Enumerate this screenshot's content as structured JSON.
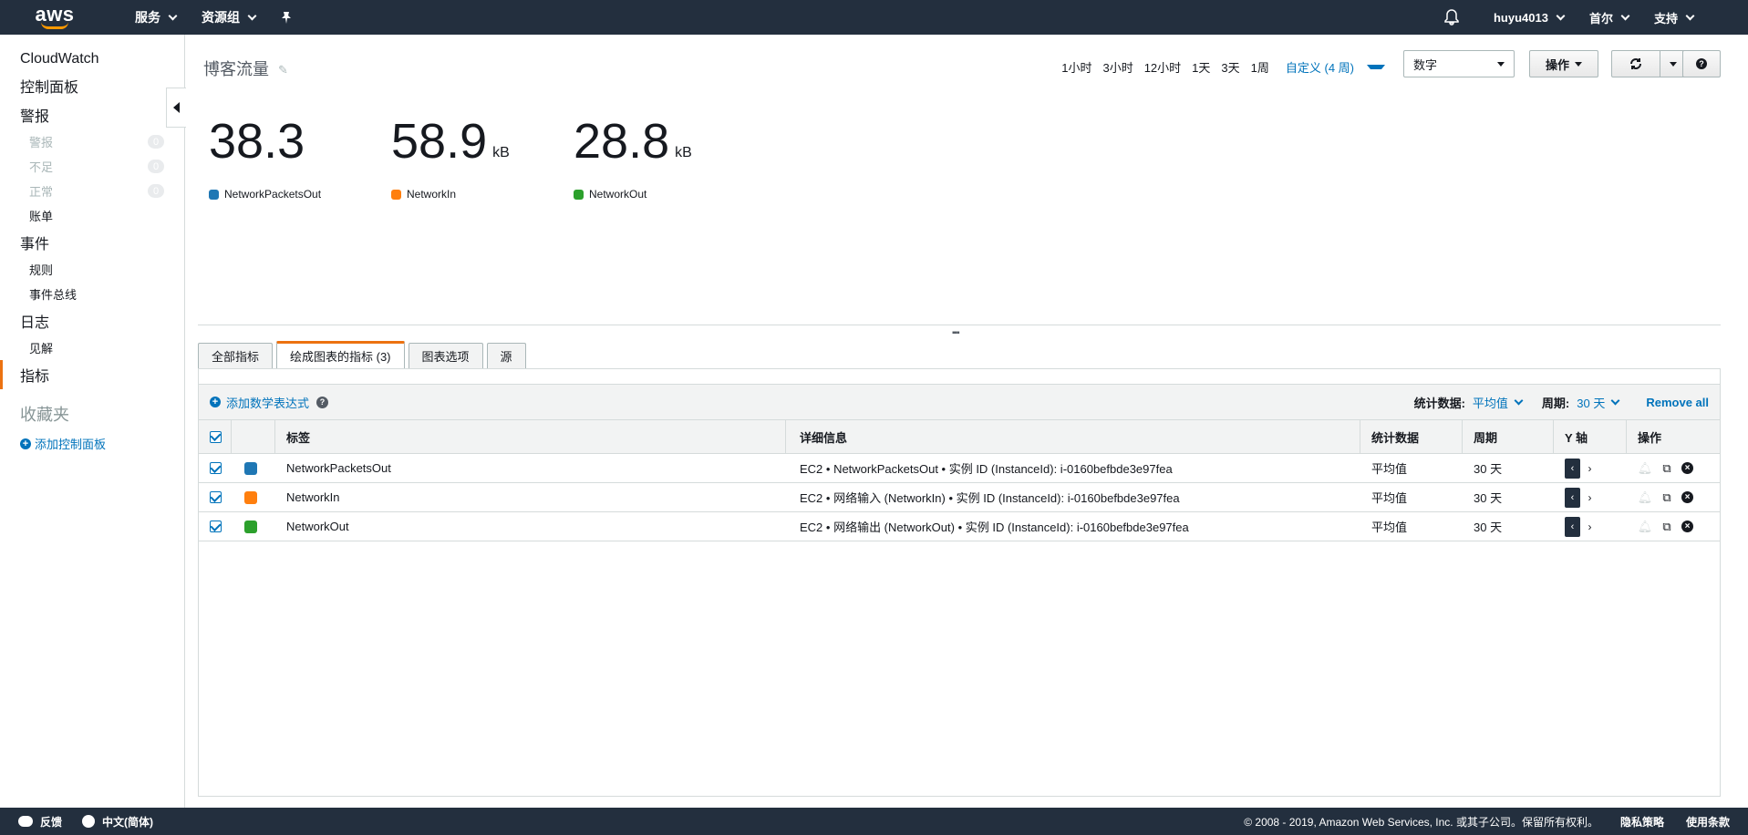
{
  "topbar": {
    "logo": "aws",
    "services": "服务",
    "resource_groups": "资源组",
    "pin_icon": "pin-icon",
    "bell_icon": "bell-icon",
    "user": "huyu4013",
    "region": "首尔",
    "support": "支持"
  },
  "sidebar": {
    "title": "CloudWatch",
    "dashboards": "控制面板",
    "alarms": "警报",
    "alarm_items": [
      {
        "label": "警报",
        "count": "0"
      },
      {
        "label": "不足",
        "count": "0"
      },
      {
        "label": "正常",
        "count": "0"
      }
    ],
    "billing": "账单",
    "events": "事件",
    "rules": "规则",
    "event_buses": "事件总线",
    "logs": "日志",
    "insights": "见解",
    "metrics": "指标",
    "favorites": "收藏夹",
    "add_dashboard": "添加控制面板"
  },
  "header": {
    "dashboard_title": "博客流量",
    "time_options": [
      "1小时",
      "3小时",
      "12小时",
      "1天",
      "3天",
      "1周"
    ],
    "custom_range": "自定义 (4 周)",
    "view_select": "数字",
    "actions": "操作"
  },
  "metrics": [
    {
      "value": "38.3",
      "unit": "",
      "name": "NetworkPacketsOut",
      "color": "#1f77b4"
    },
    {
      "value": "58.9",
      "unit": "kB",
      "name": "NetworkIn",
      "color": "#ff7f0e"
    },
    {
      "value": "28.8",
      "unit": "kB",
      "name": "NetworkOut",
      "color": "#2ca02c"
    }
  ],
  "tabs": {
    "all_metrics": "全部指标",
    "graphed_metrics": "绘成图表的指标 (3)",
    "graph_options": "图表选项",
    "source": "源"
  },
  "toolbar": {
    "add_math": "添加数学表达式",
    "stat_label": "统计数据:",
    "stat_value": "平均值",
    "period_label": "周期:",
    "period_value": "30 天",
    "remove_all": "Remove all"
  },
  "table": {
    "headers": {
      "label": "标签",
      "details": "详细信息",
      "stat": "统计数据",
      "period": "周期",
      "y_axis": "Y 轴",
      "actions": "操作"
    },
    "rows": [
      {
        "label": "NetworkPacketsOut",
        "color": "#1f77b4",
        "details": "EC2 • NetworkPacketsOut • 实例 ID (InstanceId): i-0160befbde3e97fea",
        "stat": "平均值",
        "period": "30 天"
      },
      {
        "label": "NetworkIn",
        "color": "#ff7f0e",
        "details": "EC2 • 网络输入 (NetworkIn) • 实例 ID (InstanceId): i-0160befbde3e97fea",
        "stat": "平均值",
        "period": "30 天"
      },
      {
        "label": "NetworkOut",
        "color": "#2ca02c",
        "details": "EC2 • 网络输出 (NetworkOut) • 实例 ID (InstanceId): i-0160befbde3e97fea",
        "stat": "平均值",
        "period": "30 天"
      }
    ]
  },
  "footer": {
    "feedback": "反馈",
    "language": "中文(简体)",
    "copyright": "© 2008 - 2019, Amazon Web Services, Inc. 或其子公司。保留所有权利。",
    "privacy": "隐私策略",
    "terms": "使用条款"
  }
}
